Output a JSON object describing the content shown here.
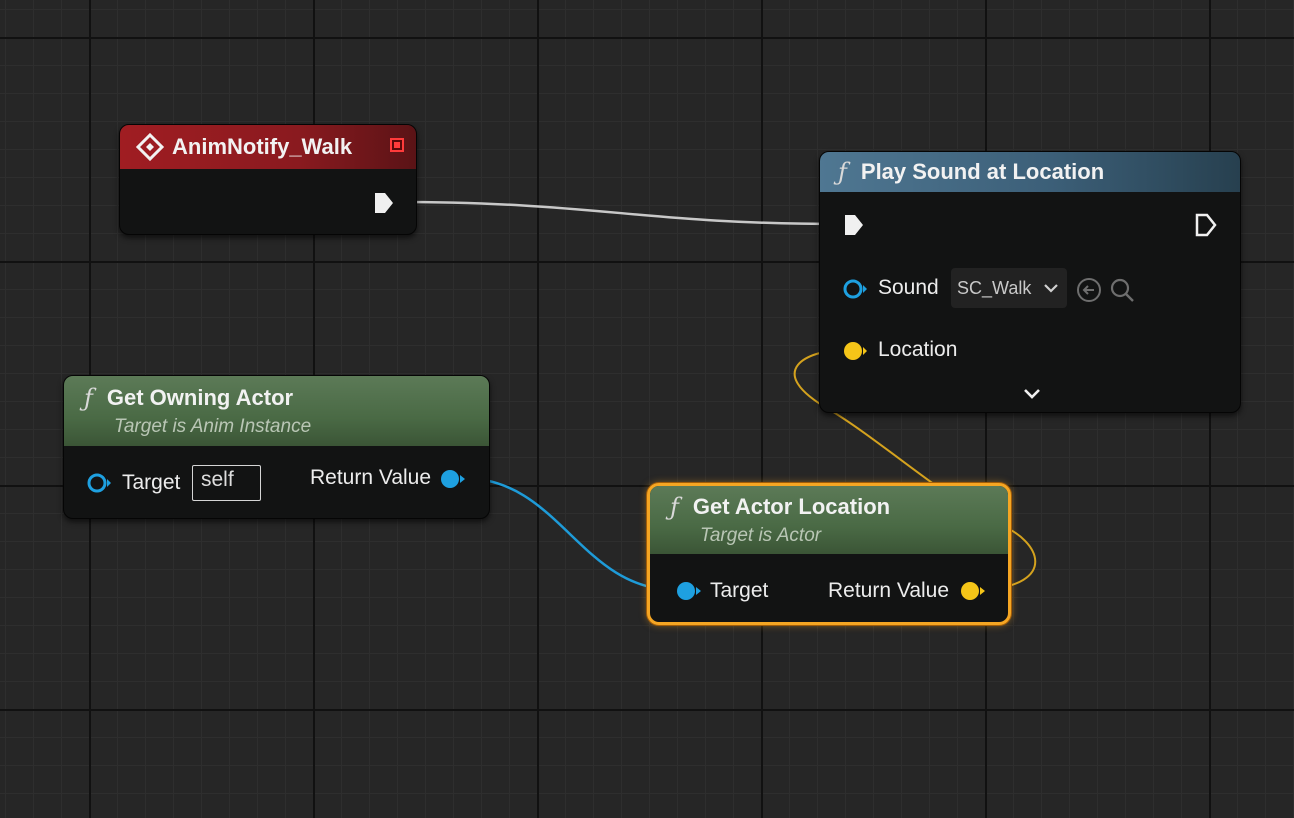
{
  "colors": {
    "exec": "#f0f0f0",
    "object_pin": "#1ea0e0",
    "vector_pin": "#f5c518",
    "selection": "#f5a623"
  },
  "nodes": {
    "anim_notify": {
      "title": "AnimNotify_Walk",
      "icon": "event-diamond-icon"
    },
    "play_sound": {
      "title": "Play Sound at Location",
      "icon": "function-icon",
      "sound_label": "Sound",
      "sound_value": "SC_Walk",
      "location_label": "Location"
    },
    "get_owning_actor": {
      "title": "Get Owning Actor",
      "subtitle": "Target is Anim Instance",
      "target_label": "Target",
      "target_value": "self",
      "return_label": "Return Value"
    },
    "get_actor_location": {
      "title": "Get Actor Location",
      "subtitle": "Target is Actor",
      "target_label": "Target",
      "return_label": "Return Value",
      "selected": true
    }
  },
  "icons": {
    "function": "ƒ"
  }
}
